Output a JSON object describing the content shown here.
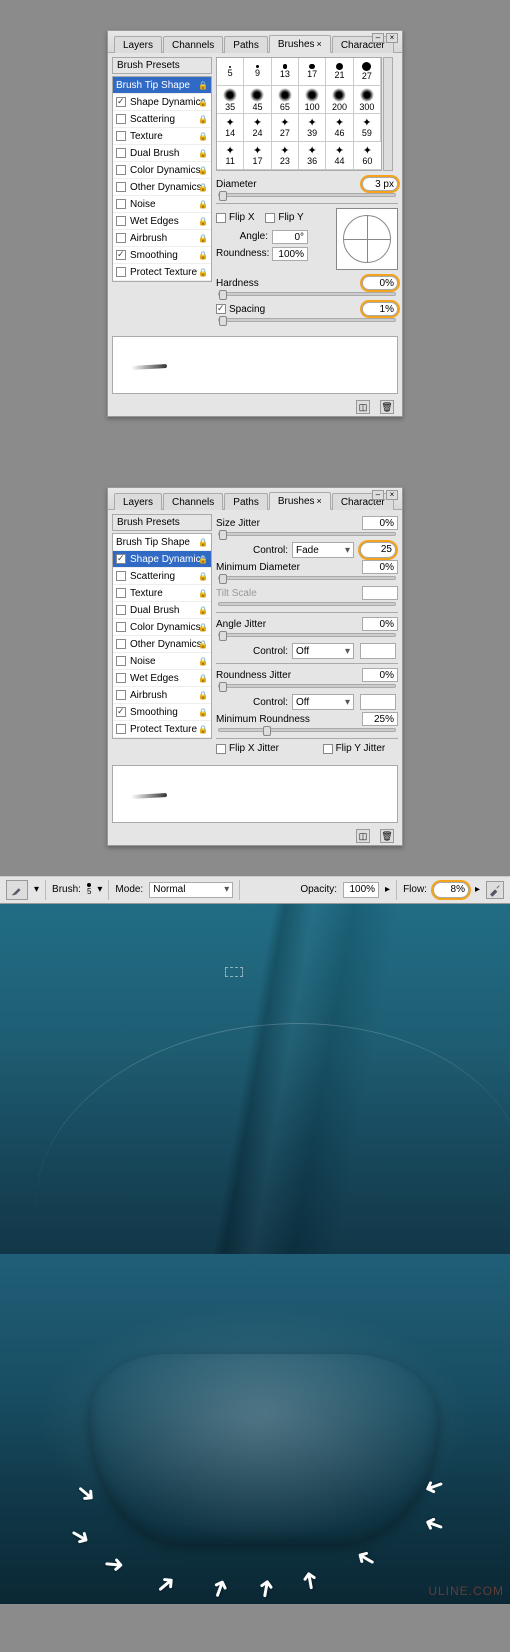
{
  "tabs": {
    "layers": "Layers",
    "channels": "Channels",
    "paths": "Paths",
    "brushes": "Brushes",
    "character": "Character"
  },
  "panel1": {
    "presets_header": "Brush Presets",
    "options": [
      {
        "label": "Brush Tip Shape",
        "checked": null
      },
      {
        "label": "Shape Dynamics",
        "checked": true
      },
      {
        "label": "Scattering",
        "checked": false
      },
      {
        "label": "Texture",
        "checked": false
      },
      {
        "label": "Dual Brush",
        "checked": false
      },
      {
        "label": "Color Dynamics",
        "checked": false
      },
      {
        "label": "Other Dynamics",
        "checked": false
      },
      {
        "label": "Noise",
        "checked": false
      },
      {
        "label": "Wet Edges",
        "checked": false
      },
      {
        "label": "Airbrush",
        "checked": false
      },
      {
        "label": "Smoothing",
        "checked": true
      },
      {
        "label": "Protect Texture",
        "checked": false
      }
    ],
    "brush_sizes_row1": [
      5,
      9,
      13,
      17,
      21,
      27
    ],
    "brush_sizes_row2": [
      35,
      45,
      65,
      100,
      200,
      300
    ],
    "brush_sizes_row3": [
      14,
      24,
      27,
      39,
      46,
      59
    ],
    "brush_sizes_row4": [
      11,
      17,
      23,
      36,
      44,
      60
    ],
    "diameter_label": "Diameter",
    "diameter_value": "3 px",
    "flipx": "Flip X",
    "flipy": "Flip Y",
    "angle_label": "Angle:",
    "angle_value": "0°",
    "round_label": "Roundness:",
    "round_value": "100%",
    "hardness_label": "Hardness",
    "hardness_value": "0%",
    "spacing_label": "Spacing",
    "spacing_value": "1%"
  },
  "panel2": {
    "presets_header": "Brush Presets",
    "options": [
      {
        "label": "Brush Tip Shape",
        "checked": null
      },
      {
        "label": "Shape Dynamics",
        "checked": true
      },
      {
        "label": "Scattering",
        "checked": false
      },
      {
        "label": "Texture",
        "checked": false
      },
      {
        "label": "Dual Brush",
        "checked": false
      },
      {
        "label": "Color Dynamics",
        "checked": false
      },
      {
        "label": "Other Dynamics",
        "checked": false
      },
      {
        "label": "Noise",
        "checked": false
      },
      {
        "label": "Wet Edges",
        "checked": false
      },
      {
        "label": "Airbrush",
        "checked": false
      },
      {
        "label": "Smoothing",
        "checked": true
      },
      {
        "label": "Protect Texture",
        "checked": false
      }
    ],
    "size_jitter_label": "Size Jitter",
    "size_jitter_value": "0%",
    "control_label": "Control:",
    "control_fade": "Fade",
    "control_fade_steps": "25",
    "min_diam_label": "Minimum Diameter",
    "min_diam_value": "0%",
    "tilt_scale_label": "Tilt Scale",
    "angle_jitter_label": "Angle Jitter",
    "angle_jitter_value": "0%",
    "control_off": "Off",
    "round_jitter_label": "Roundness Jitter",
    "round_jitter_value": "0%",
    "min_round_label": "Minimum Roundness",
    "min_round_value": "25%",
    "flip_x_jitter": "Flip X Jitter",
    "flip_y_jitter": "Flip Y Jitter"
  },
  "optbar": {
    "brush_label": "Brush:",
    "brush_size": "5",
    "mode_label": "Mode:",
    "mode_value": "Normal",
    "opacity_label": "Opacity:",
    "opacity_value": "100%",
    "flow_label": "Flow:",
    "flow_value": "8%"
  },
  "watermark": "ULINE.COM"
}
